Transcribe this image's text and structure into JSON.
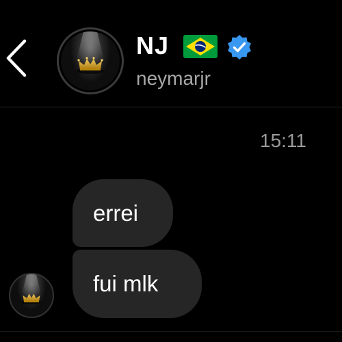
{
  "header": {
    "back_icon": "chevron-left-icon",
    "avatar_icon": "crown-icon",
    "profile_name": "NJ",
    "flag_icon": "brazil-flag-icon",
    "verified_icon": "verified-badge-icon",
    "username": "neymarjr"
  },
  "conversation": {
    "timestamp": "15:11",
    "messages": [
      {
        "sender": "neymarjr",
        "text": "errei"
      },
      {
        "sender": "neymarjr",
        "text": "fui mlk"
      }
    ],
    "sender_avatar_icon": "crown-icon"
  },
  "colors": {
    "background": "#000000",
    "bubble": "#262626",
    "text": "#ffffff",
    "secondary_text": "#a8a8a8",
    "verified_blue": "#3897f0",
    "flag_green": "#009c3b",
    "flag_yellow": "#ffdf00",
    "flag_blue": "#002776",
    "crown_gold": "#d4a017"
  }
}
